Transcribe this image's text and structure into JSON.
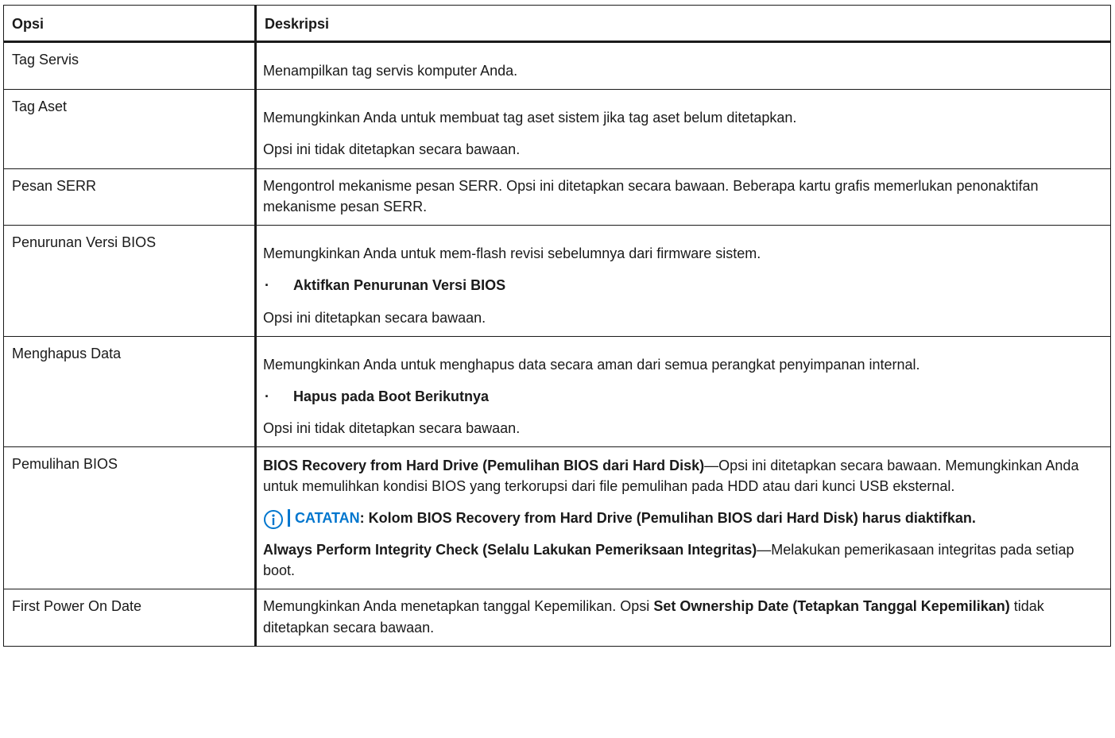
{
  "table": {
    "headers": {
      "option": "Opsi",
      "description": "Deskripsi"
    },
    "rows": [
      {
        "option": "Tag Servis",
        "p1": "Menampilkan tag servis komputer Anda."
      },
      {
        "option": "Tag Aset",
        "p1": "Memungkinkan Anda untuk membuat tag aset sistem jika tag aset belum ditetapkan.",
        "p2": "Opsi ini tidak ditetapkan secara bawaan."
      },
      {
        "option": "Pesan SERR",
        "p1": "Mengontrol mekanisme pesan SERR. Opsi ini ditetapkan secara bawaan. Beberapa kartu grafis memerlukan penonaktifan mekanisme pesan SERR."
      },
      {
        "option": "Penurunan Versi BIOS",
        "p1": "Memungkinkan Anda untuk mem-flash revisi sebelumnya dari firmware sistem.",
        "bullet": "Aktifkan Penurunan Versi BIOS",
        "p2": "Opsi ini ditetapkan secara bawaan."
      },
      {
        "option": "Menghapus Data",
        "p1": "Memungkinkan Anda untuk menghapus data secara aman dari semua perangkat penyimpanan internal.",
        "bullet": "Hapus pada Boot Berikutnya",
        "p2": "Opsi ini tidak ditetapkan secara bawaan."
      },
      {
        "option": "Pemulihan BIOS",
        "p1_bold": "BIOS Recovery from Hard Drive (Pemulihan BIOS dari Hard Disk)",
        "p1_rest": "—Opsi ini ditetapkan secara bawaan. Memungkinkan Anda untuk memulihkan kondisi BIOS yang terkorupsi dari file pemulihan pada HDD atau dari kunci USB eksternal.",
        "note_label": "CATATAN",
        "note_text": ": Kolom BIOS Recovery from Hard Drive (Pemulihan BIOS dari Hard Disk) harus diaktifkan.",
        "p2_bold": "Always Perform Integrity Check (Selalu Lakukan Pemeriksaan Integritas)",
        "p2_rest": "—Melakukan pemerikasaan integritas pada setiap boot."
      },
      {
        "option": "First Power On Date",
        "p1_a": "Memungkinkan Anda menetapkan tanggal Kepemilikan. Opsi ",
        "p1_bold": "Set Ownership Date (Tetapkan Tanggal Kepemilikan)",
        "p1_c": " tidak ditetapkan secara bawaan."
      }
    ]
  },
  "bullet_glyph": "·",
  "icons": {
    "note": "info-circle-icon"
  },
  "colors": {
    "note_accent": "#0076ce",
    "border": "#1a1a1a"
  }
}
